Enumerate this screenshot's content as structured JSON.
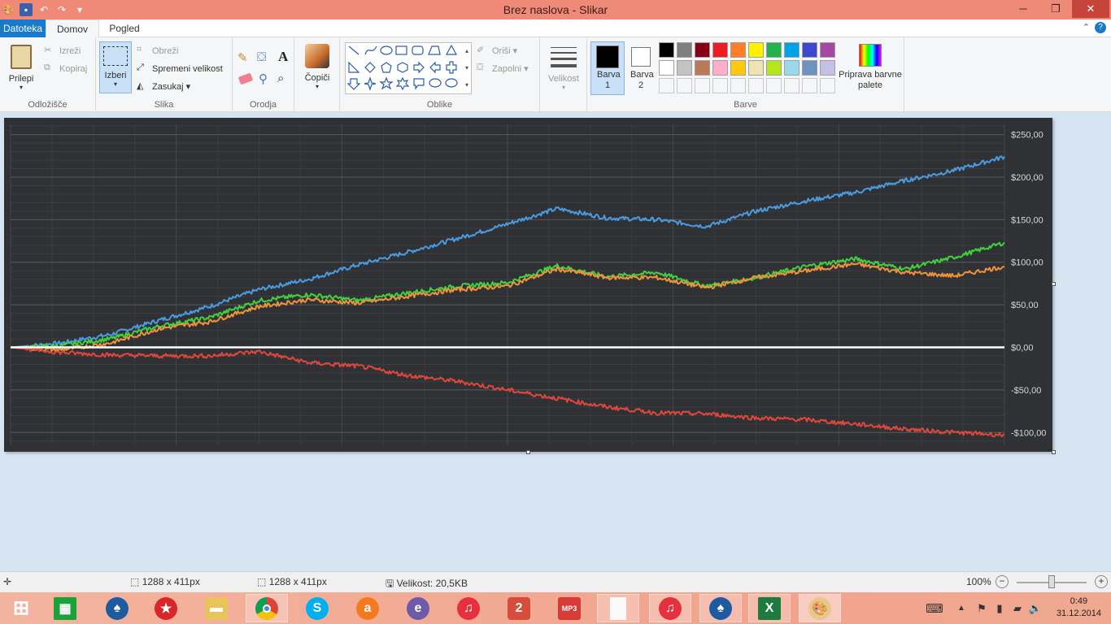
{
  "window": {
    "title": "Brez naslova - Slikar"
  },
  "tabs": {
    "file": "Datoteka",
    "home": "Domov",
    "view": "Pogled"
  },
  "clipboard": {
    "paste": "Prilepi",
    "cut": "Izreži",
    "copy": "Kopiraj",
    "label": "Odložišče"
  },
  "image": {
    "select": "Izberi",
    "crop": "Obreži",
    "resize": "Spremeni velikost",
    "rotate": "Zasukaj",
    "label": "Slika"
  },
  "tools": {
    "label": "Orodja"
  },
  "brushes": {
    "label": "Čopiči"
  },
  "shapes": {
    "outline": "Oriši",
    "fill": "Zapolni",
    "label": "Oblike"
  },
  "size": {
    "label": "Velikost"
  },
  "colors": {
    "color1": "Barva 1",
    "color2": "Barva 2",
    "edit": "Priprava barvne palete",
    "label": "Barve",
    "palette_row1": [
      "#000000",
      "#7f7f7f",
      "#880015",
      "#ed1c24",
      "#ff7f27",
      "#fff200",
      "#22b14c",
      "#00a2e8",
      "#3f48cc",
      "#a349a4"
    ],
    "palette_row2": [
      "#ffffff",
      "#c3c3c3",
      "#b97a57",
      "#ffaec9",
      "#ffc90e",
      "#efe4b0",
      "#b5e61d",
      "#99d9ea",
      "#7092be",
      "#c8bfe7"
    ]
  },
  "chart_data": {
    "type": "line",
    "ytick_labels": [
      "$250,00",
      "$200,00",
      "$150,00",
      "$100,00",
      "$50,00",
      "$0,00",
      "-$50,00",
      "-$100,00"
    ],
    "ylim": [
      -115,
      262
    ],
    "grid": true,
    "series": [
      {
        "color": "#4a9be0",
        "x": [
          0,
          5,
          10,
          15,
          20,
          25,
          30,
          35,
          40,
          45,
          50,
          55,
          60,
          65,
          70,
          75,
          80,
          85,
          90,
          95,
          100
        ],
        "values": [
          0,
          5,
          15,
          32,
          48,
          68,
          80,
          97,
          112,
          128,
          145,
          163,
          152,
          150,
          142,
          160,
          172,
          182,
          196,
          208,
          224
        ]
      },
      {
        "color": "#3fd13f",
        "x": [
          0,
          5,
          10,
          15,
          20,
          25,
          30,
          35,
          40,
          45,
          50,
          55,
          60,
          65,
          70,
          75,
          80,
          85,
          90,
          95,
          100
        ],
        "values": [
          0,
          2,
          10,
          25,
          35,
          55,
          62,
          55,
          64,
          72,
          76,
          96,
          83,
          88,
          72,
          82,
          95,
          104,
          92,
          106,
          123
        ]
      },
      {
        "color": "#f0923a",
        "x": [
          0,
          5,
          10,
          15,
          20,
          25,
          30,
          35,
          40,
          45,
          50,
          55,
          60,
          65,
          70,
          75,
          80,
          85,
          90,
          95,
          100
        ],
        "values": [
          0,
          -3,
          5,
          22,
          30,
          48,
          56,
          52,
          60,
          68,
          72,
          92,
          82,
          82,
          70,
          82,
          90,
          98,
          88,
          84,
          95
        ]
      },
      {
        "color": "#e0473c",
        "x": [
          0,
          5,
          10,
          15,
          20,
          25,
          30,
          35,
          40,
          45,
          50,
          55,
          60,
          65,
          70,
          75,
          80,
          85,
          90,
          95,
          100
        ],
        "values": [
          0,
          -6,
          -9,
          -10,
          -10,
          -5,
          -18,
          -22,
          -33,
          -40,
          -50,
          -60,
          -70,
          -77,
          -78,
          -83,
          -85,
          -90,
          -96,
          -100,
          -103
        ]
      },
      {
        "color": "#ffffff",
        "x": [
          0,
          100
        ],
        "values": [
          0,
          0
        ]
      }
    ]
  },
  "status": {
    "size1": "1288 x 411px",
    "size2": "1288 x 411px",
    "filesize": "Velikost: 20,5KB",
    "zoom": "100%"
  },
  "clock": {
    "time": "0:49",
    "date": "31.12.2014"
  }
}
